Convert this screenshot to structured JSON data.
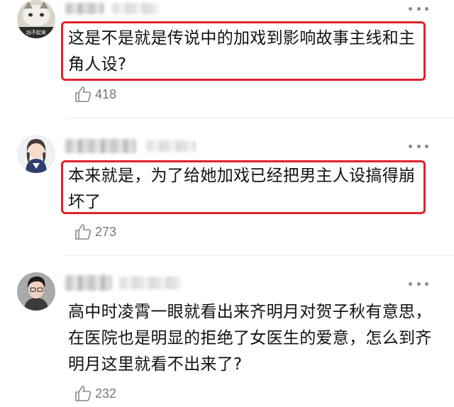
{
  "comments": [
    {
      "avatar_caption": "凶不起来",
      "text": "这是不是就是传说中的加戏到影响故事主线和主角人设?",
      "likes": "418",
      "highlighted": true
    },
    {
      "text": "本来就是，为了给她加戏已经把男主人设搞得崩坏了",
      "likes": "273",
      "highlighted": true
    },
    {
      "text": "高中时凌霄一眼就看出来齐明月对贺子秋有意思，在医院也是明显的拒绝了女医生的爱意，怎么到齐明月这里就看不出来了?",
      "likes": "232",
      "highlighted": false
    }
  ],
  "colors": {
    "highlight_border": "#e0232b",
    "like_text": "#777777"
  },
  "icons": {
    "like": "thumbs-up-icon",
    "more": "more-dots-icon"
  }
}
